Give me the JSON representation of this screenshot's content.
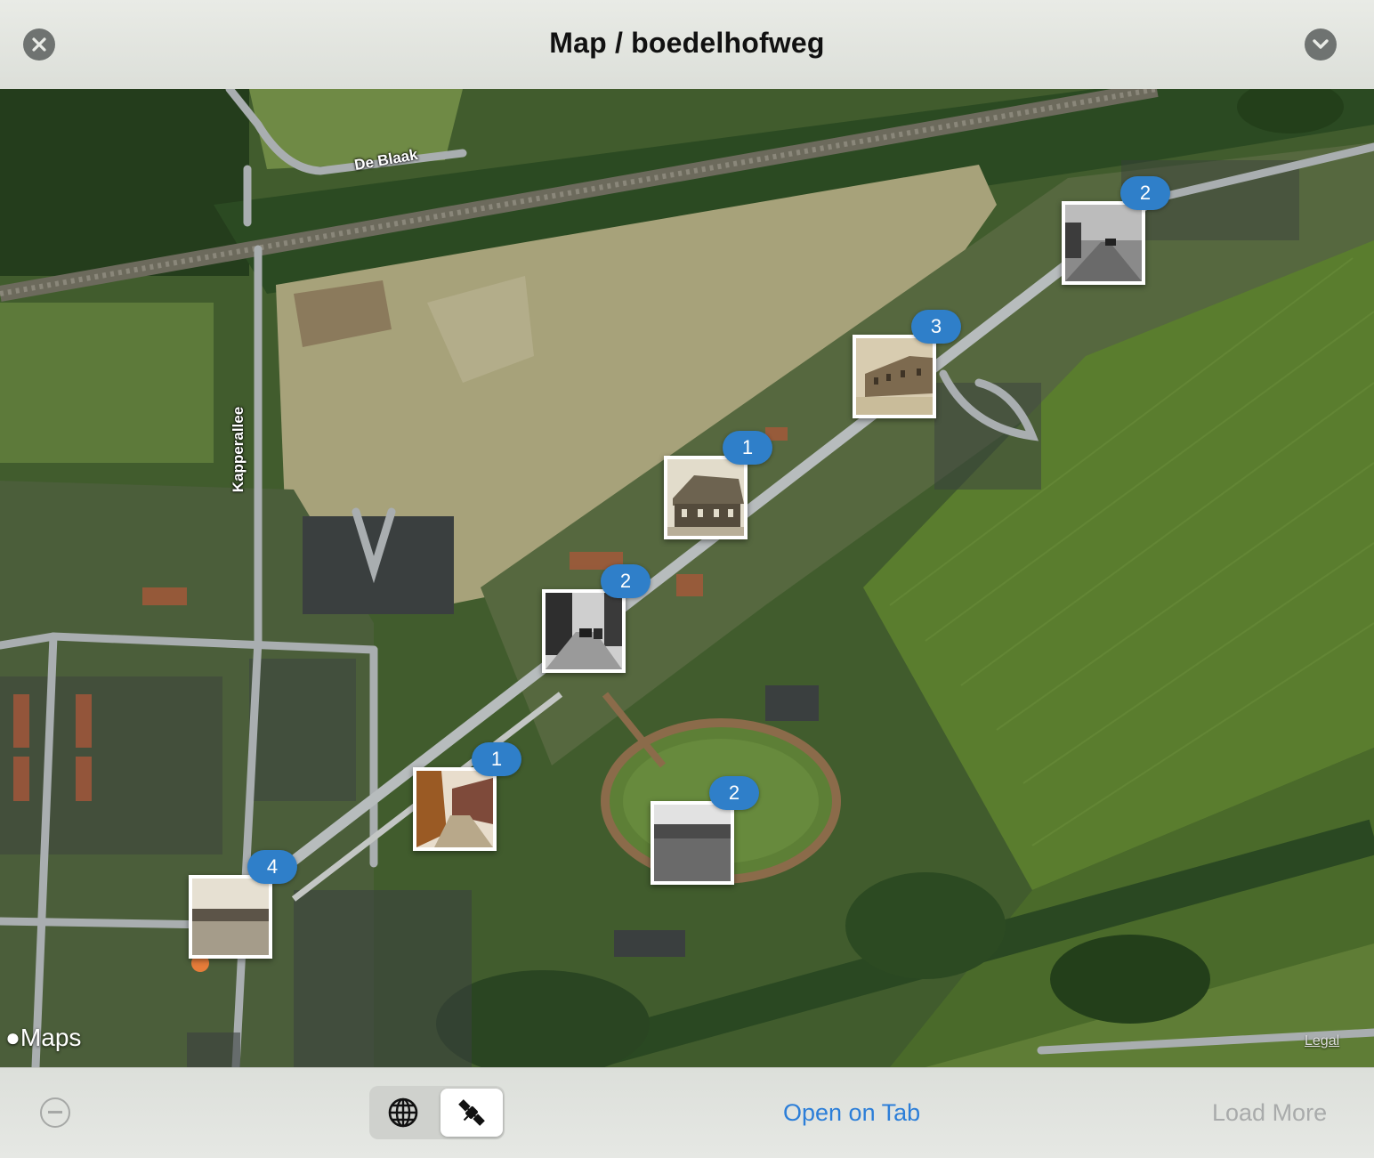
{
  "header": {
    "title": "Map / boedelhofweg"
  },
  "map": {
    "road_labels": [
      "De Blaak",
      "Kapperallee"
    ],
    "attribution": "Maps",
    "legal": "Legal",
    "markers": [
      {
        "count": "2",
        "photo": "street-bw-cars"
      },
      {
        "count": "3",
        "photo": "row-houses-sepia"
      },
      {
        "count": "1",
        "photo": "farmhouse-sepia"
      },
      {
        "count": "2",
        "photo": "street-bw-cyclists"
      },
      {
        "count": "1",
        "photo": "avenue-color"
      },
      {
        "count": "2",
        "photo": "field-bw"
      },
      {
        "count": "4",
        "photo": "landscape-sepia"
      }
    ]
  },
  "footer": {
    "open_tab_label": "Open on Tab",
    "load_more_label": "Load More",
    "segments": [
      "globe-icon",
      "satellite-icon"
    ],
    "selected_segment": "satellite-icon"
  },
  "colors": {
    "accent": "#2c7ed8",
    "badge": "#2f7fc9"
  }
}
